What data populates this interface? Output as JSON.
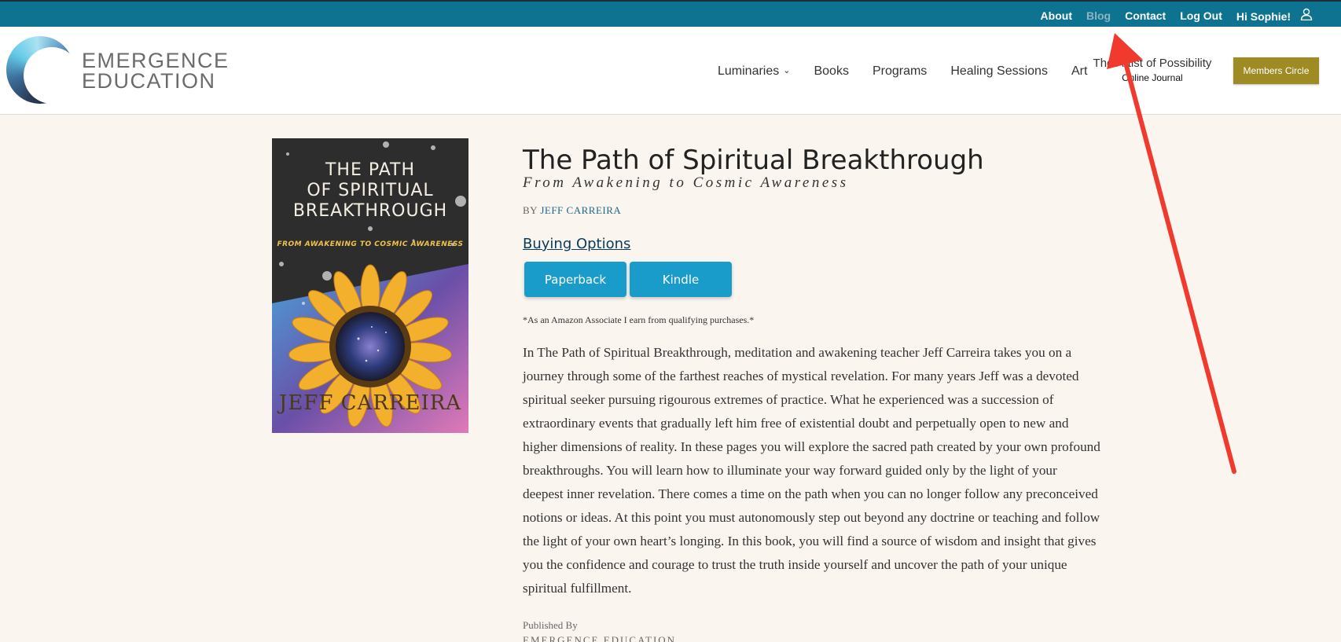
{
  "topbar": {
    "links": [
      "About",
      "Blog",
      "Contact",
      "Log Out"
    ],
    "greeting": "Hi Sophie!",
    "user_icon": "user-icon"
  },
  "header": {
    "logo": {
      "line1": "EMERGENCE",
      "line2": "EDUCATION"
    },
    "nav": [
      {
        "label": "Luminaries",
        "dropdown": true
      },
      {
        "label": "Books"
      },
      {
        "label": "Programs"
      },
      {
        "label": "Healing Sessions"
      },
      {
        "label": "Art"
      }
    ],
    "artist": {
      "title": "The Artist of Possibility",
      "subtitle": "Online Journal"
    },
    "members_button": "Members Circle",
    "colors": {
      "topbar": "#0e7390",
      "members": "#9f8b23"
    }
  },
  "cover": {
    "title_lines": [
      "THE PATH",
      "OF SPIRITUAL",
      "BREAKTHROUGH"
    ],
    "subtitle": "FROM AWAKENING TO COSMIC AWARENESS",
    "author": "JEFF CARREIRA"
  },
  "book": {
    "title": "The Path of Spiritual Breakthrough",
    "subtitle": "From Awakening to Cosmic Awareness",
    "by_label": "BY",
    "author": "JEFF CARREIRA",
    "buying_options": "Buying Options",
    "buttons": {
      "paperback": "Paperback",
      "kindle": "Kindle"
    },
    "button_color": "#1a9ccb",
    "associate_note": "*As an Amazon Associate I earn from qualifying purchases.*",
    "description": "In The Path of Spiritual Breakthrough, meditation and awakening teacher Jeff Carreira takes you on a journey through some of the farthest reaches of mystical revelation. For many years Jeff was a devoted spiritual seeker pursuing rigourous extremes of practice. What he experienced was a succession of extraordinary events that gradually left him free of existential doubt and perpetually open to new and higher dimensions of reality. In these pages you will explore the sacred path created by your own profound breakthroughs. You will learn how to illuminate your way forward guided only by the light of your deepest inner revelation. There comes a time on the path when you can no longer follow any preconceived notions or ideas. At this point you must autonomously step out beyond any doctrine or teaching and follow the light of your own heart’s longing. In this book, you will find a source of wisdom and insight that gives you the confidence and courage to trust the truth inside yourself and uncover the path of your unique spiritual fulfillment.",
    "published_by_label": "Published By",
    "publisher": "EMERGENCE EDUCATION"
  },
  "annotation": {
    "color": "#f03a2e"
  }
}
